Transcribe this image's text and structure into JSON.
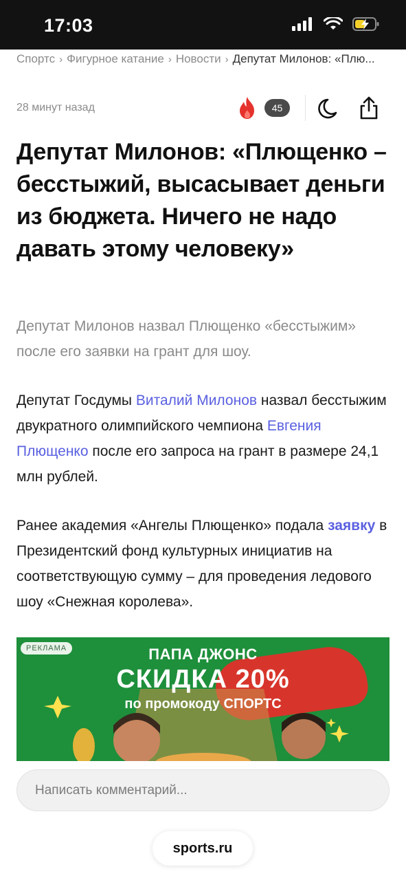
{
  "status_bar": {
    "time": "17:03",
    "icons": [
      "signal-icon",
      "wifi-icon",
      "battery-charging-icon"
    ]
  },
  "breadcrumb": [
    {
      "label": "Спортс"
    },
    {
      "label": "Фигурное катание"
    },
    {
      "label": "Новости"
    },
    {
      "label": "Депутат Милонов: «Плю..."
    }
  ],
  "meta": {
    "timestamp": "28 минут назад",
    "reactions_count": "45",
    "icons": [
      "fire-icon",
      "moon-icon",
      "share-icon"
    ]
  },
  "article": {
    "headline": "Депутат Милонов: «Плющенко – бесстыжий, высасывает деньги из бюджета. Ничего не надо давать этому человеку»",
    "lead": "Депутат Милонов назвал Плющенко «бесстыжим» после его заявки на грант для шоу.",
    "para1": {
      "t1": "Депутат Госдумы ",
      "link1": "Виталий Милонов",
      "t2": " назвал бесстыжим двукратного олимпийского чемпиона ",
      "link2": "Евгения Плющенко",
      "t3": " после его запроса на грант в размере 24,1 млн рублей."
    },
    "para2": {
      "t1": "Ранее академия «Ангелы Плющенко» подала ",
      "link": "заявку",
      "t2": " в Президентский фонд культурных инициатив на соответствующую сумму – для проведения ледового шоу «Снежная королева»."
    }
  },
  "ad": {
    "label": "РЕКЛАМА",
    "brand": "ПАПА ДЖОНС",
    "headline": "СКИДКА 20%",
    "subline": "по промокоду СПОРТС",
    "colors": {
      "background": "#1e8f3b",
      "accent": "#e2302a"
    }
  },
  "comment": {
    "placeholder": "Написать комментарий..."
  },
  "site": {
    "label": "sports.ru"
  },
  "colors": {
    "link": "#5a60e0",
    "muted_text": "#8a8a8a",
    "fire": "#e5322d"
  }
}
